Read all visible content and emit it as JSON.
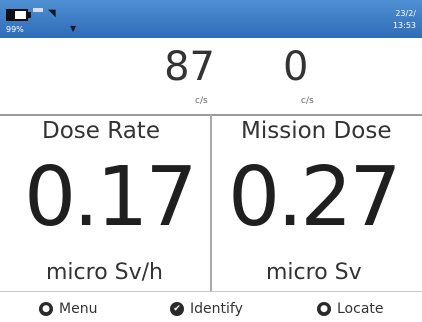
{
  "status_bar": {
    "battery_percent": "99%",
    "date": "23/2/",
    "time": "13:53"
  },
  "counts": {
    "left": {
      "value": "87",
      "unit": "c/s"
    },
    "right": {
      "value": "0",
      "unit": "c/s"
    }
  },
  "panels": {
    "dose_rate": {
      "label": "Dose Rate",
      "value": "0.17",
      "unit": "micro Sv/h"
    },
    "mission_dose": {
      "label": "Mission Dose",
      "value": "0.27",
      "unit": "micro Sv"
    }
  },
  "softkeys": {
    "menu": "Menu",
    "identify": "Identify",
    "locate": "Locate"
  }
}
